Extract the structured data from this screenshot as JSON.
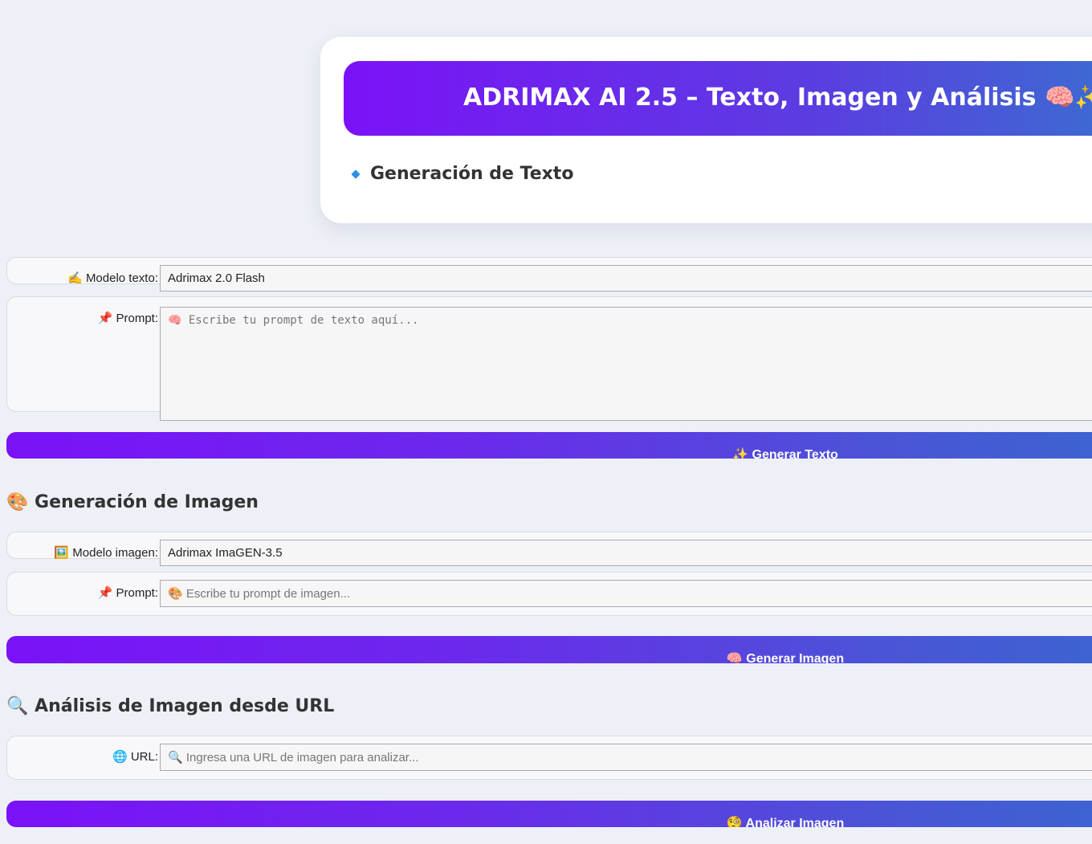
{
  "header": {
    "title": "ADRIMAX AI 2.5 – Texto, Imagen y Análisis 🧠✨",
    "subtitle": "Generación de Texto"
  },
  "text_section": {
    "model_label": "✍️ Modelo texto:",
    "model_value": "Adrimax 2.0 Flash",
    "prompt_label": "📌 Prompt:",
    "prompt_placeholder": "🧠 Escribe tu prompt de texto aquí...",
    "button_label": "✨ Generar Texto"
  },
  "image_section": {
    "title": "🎨 Generación de Imagen",
    "model_label": "🖼️ Modelo imagen:",
    "model_value": "Adrimax ImaGEN-3.5",
    "prompt_label": "📌 Prompt:",
    "prompt_placeholder": "🎨 Escribe tu prompt de imagen...",
    "button_label": "🧠 Generar Imagen"
  },
  "analysis_section": {
    "title": "🔍 Análisis de Imagen desde URL",
    "url_label": "🌐 URL:",
    "url_placeholder": "🔍 Ingresa una URL de imagen para analizar...",
    "button_label": "🧐 Analizar Imagen"
  },
  "colors": {
    "accent_start": "#7b12f7",
    "accent_end": "#3a6fd0",
    "page_background": "#eef0f7"
  }
}
